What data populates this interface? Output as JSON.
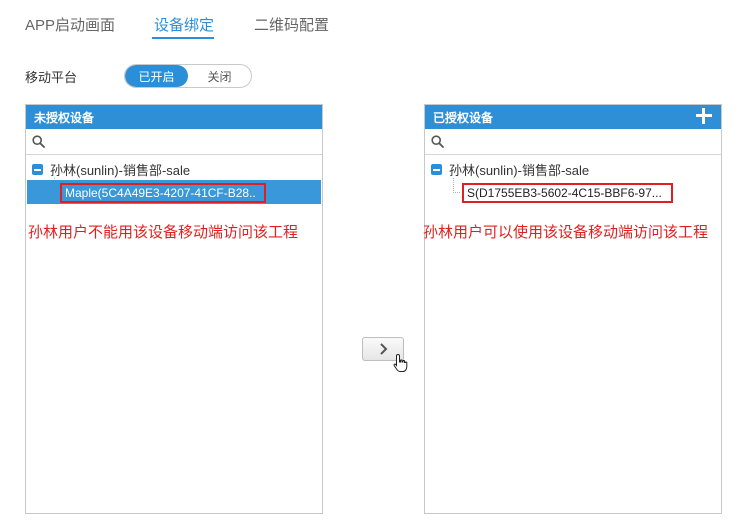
{
  "tabs": [
    {
      "label": "APP启动画面"
    },
    {
      "label": "设备绑定"
    },
    {
      "label": "二维码配置"
    }
  ],
  "platform": {
    "label": "移动平台",
    "on_label": "已开启",
    "off_label": "关闭"
  },
  "unauthorized_panel": {
    "title": "未授权设备",
    "user_node": "孙林(sunlin)-销售部-sale",
    "device": "Maple(5C4A49E3-4207-41CF-B28..",
    "annotation": "孙林用户不能用该设备移动端访问该工程"
  },
  "authorized_panel": {
    "title": "已授权设备",
    "user_node": "孙林(sunlin)-销售部-sale",
    "device": "S(D1755EB3-5602-4C15-BBF6-97...",
    "annotation": "孙林用户可以使用该设备移动端访问该工程"
  },
  "icons": {
    "search": "search-icon",
    "add": "plus-icon",
    "collapse": "minus-square-icon",
    "move": "chevron-right-icon",
    "cursor": "hand-pointer-icon"
  },
  "colors": {
    "accent": "#2a8fd8",
    "header": "#2e8fd6",
    "selected": "#3a97d9",
    "annotation": "#e02020"
  }
}
